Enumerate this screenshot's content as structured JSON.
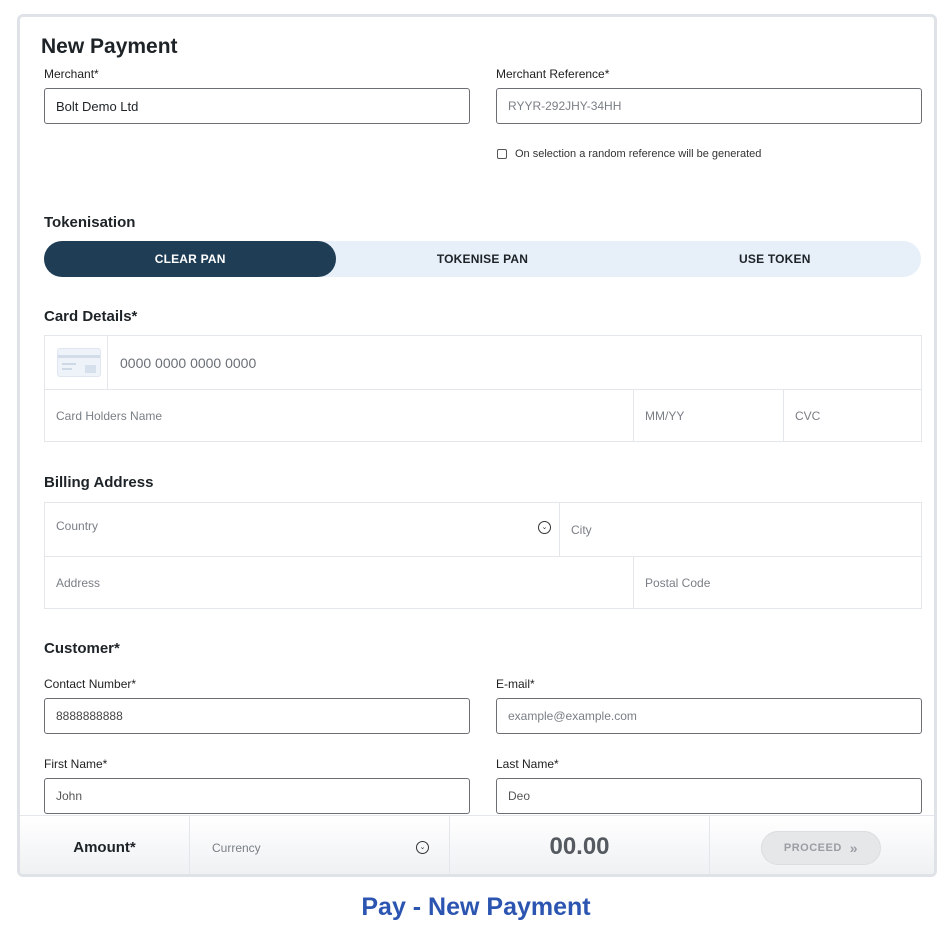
{
  "page": {
    "title": "New Payment"
  },
  "merchant": {
    "merchant_label": "Merchant*",
    "merchant_value": "Bolt Demo Ltd",
    "reference_label": "Merchant Reference*",
    "reference_placeholder": "RYYR-292JHY-34HH",
    "random_ref_label": "On selection a random reference will be generated"
  },
  "tokenisation": {
    "title": "Tokenisation",
    "options": [
      "CLEAR PAN",
      "TOKENISE PAN",
      "USE TOKEN"
    ],
    "active": "CLEAR PAN"
  },
  "card_details": {
    "title": "Card Details*",
    "number_placeholder": "0000 0000 0000 0000",
    "holder_placeholder": "Card Holders Name",
    "expiry_placeholder": "MM/YY",
    "cvc_placeholder": "CVC"
  },
  "billing": {
    "title": "Billing Address",
    "country_placeholder": "Country",
    "city_placeholder": "City",
    "address_placeholder": "Address",
    "postal_placeholder": "Postal Code"
  },
  "customer": {
    "title": "Customer*",
    "contact_label": "Contact Number*",
    "contact_value": "8888888888",
    "email_label": "E-mail*",
    "email_placeholder": "example@example.com",
    "first_label": "First Name*",
    "first_value": "John",
    "last_label": "Last Name*",
    "last_value": "Deo"
  },
  "footer": {
    "amount_label": "Amount*",
    "currency_placeholder": "Currency",
    "amount_value": "00.00",
    "proceed_label": "PROCEED"
  },
  "caption": "Pay - New Payment",
  "colors": {
    "primary": "#1f3d55",
    "segment_bg": "#e7eff8",
    "caption": "#2b55b0"
  }
}
